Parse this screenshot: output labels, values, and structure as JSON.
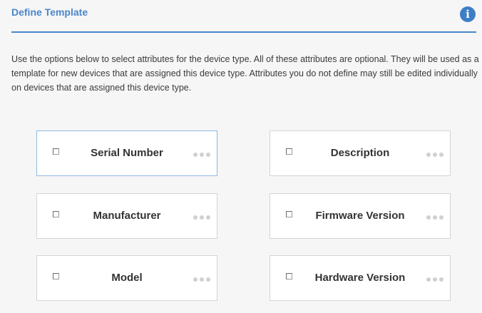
{
  "header": {
    "title": "Define Template",
    "info_icon": "info-circle-icon"
  },
  "description": "Use the options below to select attributes for the device type. All of these attributes are optional. They will be used as a template for new devices that are assigned this device type. Attributes you do not define may still be edited individually on devices that are assigned this device type.",
  "attributes": [
    {
      "label": "Serial Number",
      "checked": false,
      "selected": true
    },
    {
      "label": "Description",
      "checked": false,
      "selected": false
    },
    {
      "label": "Manufacturer",
      "checked": false,
      "selected": false
    },
    {
      "label": "Firmware Version",
      "checked": false,
      "selected": false
    },
    {
      "label": "Model",
      "checked": false,
      "selected": false
    },
    {
      "label": "Hardware Version",
      "checked": false,
      "selected": false
    }
  ],
  "colors": {
    "accent": "#4a86c8",
    "info_icon": "#3d7fc6",
    "selected_border": "#8fb7e0",
    "card_border": "#d4d4d4"
  }
}
